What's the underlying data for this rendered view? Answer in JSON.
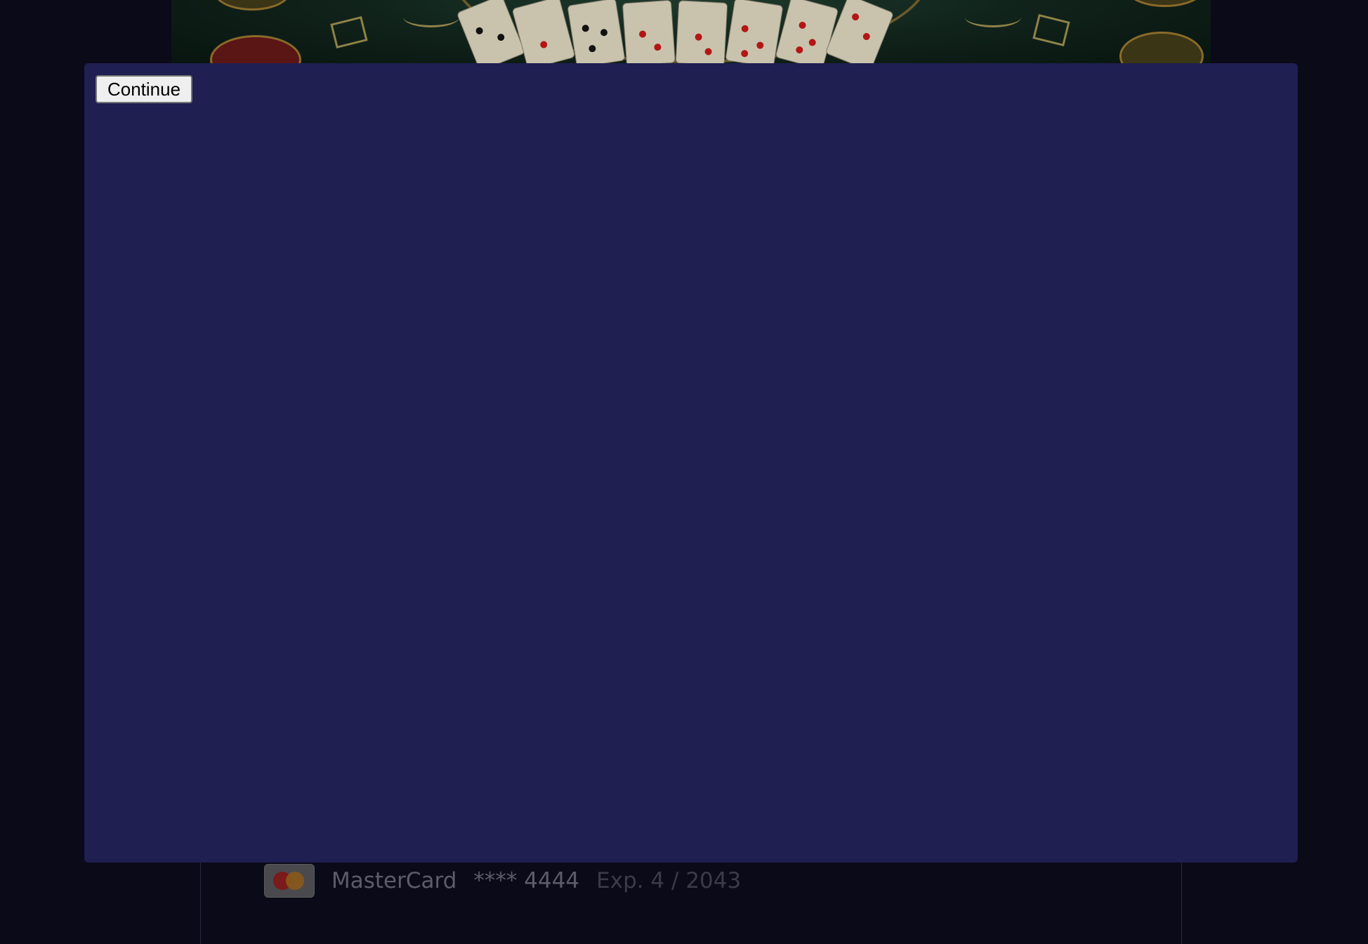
{
  "modal": {
    "continue_label": "Continue"
  },
  "payment": {
    "brand": "MasterCard",
    "masked_number": "**** 4444",
    "expiry": "Exp. 4 / 2043"
  },
  "colors": {
    "modal_bg": "#1f1f52",
    "page_bg": "#0a0a18",
    "banner_felt": "#10231b"
  }
}
